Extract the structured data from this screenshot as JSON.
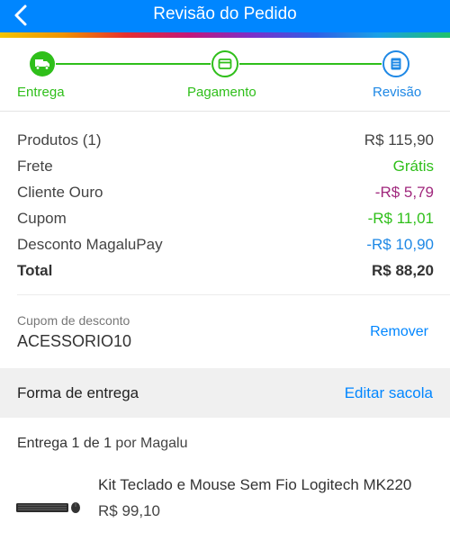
{
  "header": {
    "title": "Revisão do Pedido",
    "back_icon": "chevron-left-icon"
  },
  "colors": {
    "primary": "#0086ff",
    "green": "#2fbf1a",
    "purple": "#a0287d",
    "blue": "#1e88e5"
  },
  "steps": [
    {
      "label": "Entrega",
      "icon": "truck-icon",
      "state": "done"
    },
    {
      "label": "Pagamento",
      "icon": "credit-card-icon",
      "state": "done"
    },
    {
      "label": "Revisão",
      "icon": "document-icon",
      "state": "current"
    }
  ],
  "summary": {
    "products": {
      "label": "Produtos (1)",
      "value": "R$ 115,90"
    },
    "shipping": {
      "label": "Frete",
      "value": "Grátis"
    },
    "gold_client": {
      "label": "Cliente Ouro",
      "value": "-R$ 5,79"
    },
    "coupon": {
      "label": "Cupom",
      "value": "-R$ 11,01"
    },
    "magalupay": {
      "label": "Desconto MagaluPay",
      "value": "-R$ 10,90"
    },
    "total": {
      "label": "Total",
      "value": "R$ 88,20"
    }
  },
  "coupon_section": {
    "label": "Cupom de desconto",
    "code": "ACESSORIO10",
    "remove_label": "Remover"
  },
  "delivery": {
    "title": "Forma de entrega",
    "edit_label": "Editar sacola",
    "info_bold": "Entrega 1 de 1",
    "info_rest": " por Magalu"
  },
  "product": {
    "name": "Kit Teclado e Mouse Sem Fio Logitech MK220",
    "price": "R$ 99,10"
  }
}
